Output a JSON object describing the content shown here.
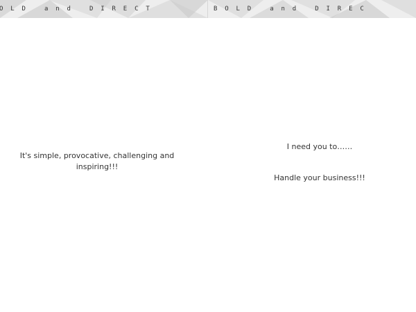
{
  "colors": {
    "header_light": "#eeeeee",
    "header_mid": "#d9d9d9",
    "header_dark": "#c7c7c7",
    "text": "#333333"
  },
  "left_page": {
    "header_text": "O  L  D     a  n  d     D  I  R  E  C  T",
    "quote": "It's simple, provocative, challenging and inspiring!!!"
  },
  "right_page": {
    "header_text": "B  O  L  D     a  n  d     D  I  R  E  C",
    "line_1": "I need you to……",
    "line_2": "Handle your business!!!"
  }
}
